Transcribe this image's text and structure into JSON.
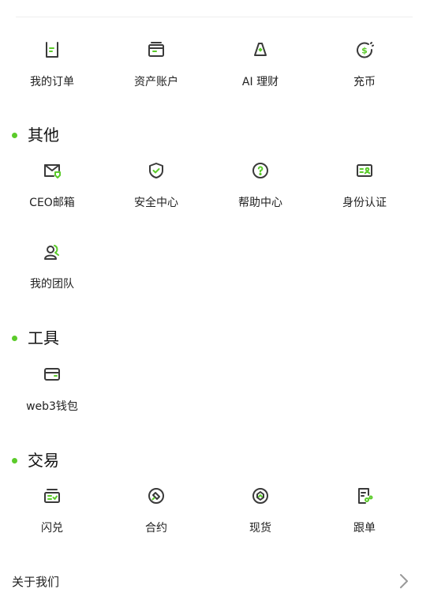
{
  "colors": {
    "accent": "#5bcb2a",
    "icon_stroke": "#3a3a3a",
    "text": "#222222"
  },
  "row1": [
    {
      "label": "我的订单",
      "icon": "order-icon"
    },
    {
      "label": "资产账户",
      "icon": "wallet-icon"
    },
    {
      "label": "AI 理财",
      "icon": "ai-finance-icon"
    },
    {
      "label": "充币",
      "icon": "deposit-icon"
    }
  ],
  "sections": {
    "other": {
      "title": "其他",
      "items": [
        {
          "label": "CEO邮箱",
          "icon": "mail-icon"
        },
        {
          "label": "安全中心",
          "icon": "shield-icon"
        },
        {
          "label": "帮助中心",
          "icon": "help-icon"
        },
        {
          "label": "身份认证",
          "icon": "id-card-icon"
        },
        {
          "label": "我的团队",
          "icon": "team-icon"
        }
      ]
    },
    "tools": {
      "title": "工具",
      "items": [
        {
          "label": "web3钱包",
          "icon": "web3-wallet-icon"
        }
      ]
    },
    "trade": {
      "title": "交易",
      "items": [
        {
          "label": "闪兑",
          "icon": "swap-icon"
        },
        {
          "label": "合约",
          "icon": "contract-icon"
        },
        {
          "label": "现货",
          "icon": "spot-icon"
        },
        {
          "label": "跟单",
          "icon": "copy-trade-icon"
        }
      ]
    }
  },
  "about": {
    "label": "关于我们",
    "icon": "chevron-right-icon"
  }
}
